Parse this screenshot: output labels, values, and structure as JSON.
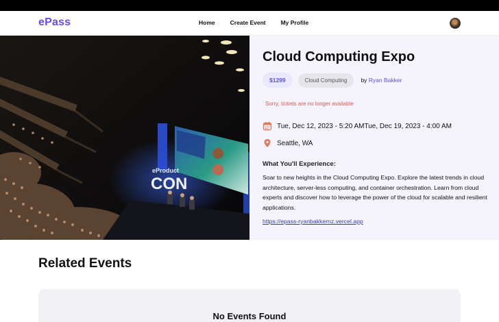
{
  "brand": {
    "logo": "ePass",
    "accent": "#624cf5"
  },
  "nav": {
    "items": [
      "Home",
      "Create Event",
      "My Profile"
    ]
  },
  "event": {
    "title": "Cloud Computing Expo",
    "price": "$1299",
    "category": "Cloud Computing",
    "by_prefix": "by",
    "organizer": "Ryan Bakker",
    "status_message": "Sorry, tickets are no longer available",
    "dates": "Tue, Dec 12, 2023 - 5:20 AMTue, Dec 19, 2023 - 4:00 AM",
    "location": "Seattle, WA",
    "experience_title": "What You'll Experience:",
    "description": "Soar to new heights in the Cloud Computing Expo. Explore the latest trends in cloud architecture, server-less computing, and container orchestration. Learn from cloud experts and discover how to leverage the power of the cloud for scalable and resilient applications.",
    "url": "https://epass-ryanbakkernz.vercel.app",
    "image": {
      "stage_sign": "eProduct\nCON"
    },
    "icons": {
      "date": "calendar-icon",
      "location": "map-pin-icon"
    },
    "colors": {
      "status": "#e05a4f",
      "icon": "#e07a5f"
    }
  },
  "related": {
    "title": "Related Events",
    "empty_message": "No Events Found"
  }
}
